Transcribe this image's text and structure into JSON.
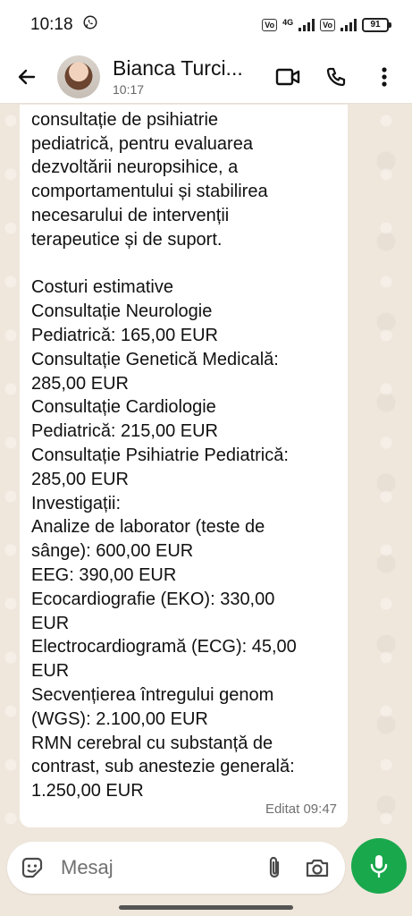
{
  "status": {
    "time": "10:18",
    "network": "4G",
    "battery": "91"
  },
  "header": {
    "contact_name": "Bianca Turci...",
    "last_seen": "10:17"
  },
  "message": {
    "text": "multidisciplinară, incluzând\nconsultație de psihiatrie\npediatrică, pentru evaluarea\ndezvoltării neuropsihice, a\ncomportamentului și stabilirea\nnecesarului de intervenții\nterapeutice și de suport.\n\nCosturi estimative\nConsultație Neurologie\nPediatrică: 165,00 EUR\nConsultație Genetică Medicală:\n285,00 EUR\nConsultație Cardiologie\nPediatrică: 215,00 EUR\nConsultație Psihiatrie Pediatrică:\n285,00 EUR\nInvestigații:\nAnalize de laborator (teste de\nsânge): 600,00 EUR\nEEG: 390,00 EUR\nEcocardiografie (EKO): 330,00\nEUR\nElectrocardiogramă (ECG): 45,00\nEUR\nSecvențierea întregului genom\n(WGS): 2.100,00 EUR\nRMN cerebral cu substanță de\ncontrast, sub anestezie generală:\n1.250,00 EUR",
    "meta": "Editat 09:47"
  },
  "composer": {
    "placeholder": "Mesaj"
  },
  "colors": {
    "accent": "#1aa84d",
    "chat_bg": "#efe7dc",
    "bubble": "#ffffff"
  }
}
